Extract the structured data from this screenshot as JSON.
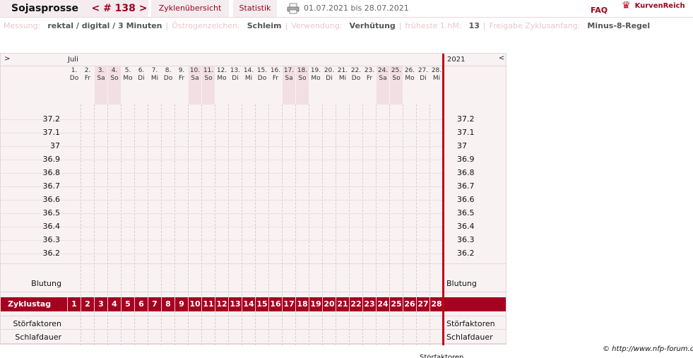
{
  "header": {
    "title": "Sojasprosse",
    "cycle": "< # 138 >",
    "overview": "Zyklenübersicht",
    "stats": "Statistik",
    "date_range": "01.07.2021 bis 28.07.2021",
    "faq": "FAQ",
    "logo": "KurvenReich",
    "print_icon": "printer-icon"
  },
  "info": [
    {
      "label": "Messung:",
      "value": "rektal / digital / 3 Minuten"
    },
    {
      "label": "Östrogenzeichen:",
      "value": "Schleim"
    },
    {
      "label": "Verwendung:",
      "value": "Verhütung"
    },
    {
      "label": "früheste 1.hM:",
      "value": "13"
    },
    {
      "label": "Freigabe Zyklusanfang:",
      "value": "Minus-8-Regel"
    }
  ],
  "chart": {
    "nav_left": ">",
    "nav_right": "<",
    "month": "Juli",
    "year": "2021",
    "days": [
      {
        "n": "1.",
        "d": "Do"
      },
      {
        "n": "2.",
        "d": "Fr"
      },
      {
        "n": "3.",
        "d": "Sa"
      },
      {
        "n": "4.",
        "d": "So"
      },
      {
        "n": "5.",
        "d": "Mo"
      },
      {
        "n": "6.",
        "d": "Di"
      },
      {
        "n": "7.",
        "d": "Mi"
      },
      {
        "n": "8.",
        "d": "Do"
      },
      {
        "n": "9.",
        "d": "Fr"
      },
      {
        "n": "10.",
        "d": "Sa"
      },
      {
        "n": "11.",
        "d": "So"
      },
      {
        "n": "12.",
        "d": "Mo"
      },
      {
        "n": "13.",
        "d": "Di"
      },
      {
        "n": "14.",
        "d": "Mi"
      },
      {
        "n": "15.",
        "d": "Do"
      },
      {
        "n": "16.",
        "d": "Fr"
      },
      {
        "n": "17.",
        "d": "Sa"
      },
      {
        "n": "18.",
        "d": "So"
      },
      {
        "n": "19.",
        "d": "Mo"
      },
      {
        "n": "20.",
        "d": "Di"
      },
      {
        "n": "21.",
        "d": "Mi"
      },
      {
        "n": "22.",
        "d": "Do"
      },
      {
        "n": "23.",
        "d": "Fr"
      },
      {
        "n": "24.",
        "d": "Sa"
      },
      {
        "n": "25.",
        "d": "So"
      },
      {
        "n": "26.",
        "d": "Mo"
      },
      {
        "n": "27.",
        "d": "Di"
      },
      {
        "n": "28.",
        "d": "Mi"
      }
    ],
    "temps": [
      "37.2",
      "37.1",
      "37",
      "36.9",
      "36.8",
      "36.7",
      "36.6",
      "36.5",
      "36.4",
      "36.3",
      "36.2"
    ],
    "bleeding_label": "Blutung",
    "cycle_label": "Zyklustag",
    "cycle_days": [
      "1",
      "2",
      "3",
      "4",
      "5",
      "6",
      "7",
      "8",
      "9",
      "10",
      "11",
      "12",
      "13",
      "14",
      "15",
      "16",
      "17",
      "18",
      "19",
      "20",
      "21",
      "22",
      "23",
      "24",
      "25",
      "26",
      "27",
      "28"
    ],
    "disturb_label": "Störfaktoren",
    "sleep_label": "Schlafdauer",
    "weekend_color": "#f1dfe3",
    "accent_color": "#a50020"
  },
  "footer": {
    "copyright": "© http://www.nfp-forum.de",
    "cut_text": "Störfaktoren"
  }
}
